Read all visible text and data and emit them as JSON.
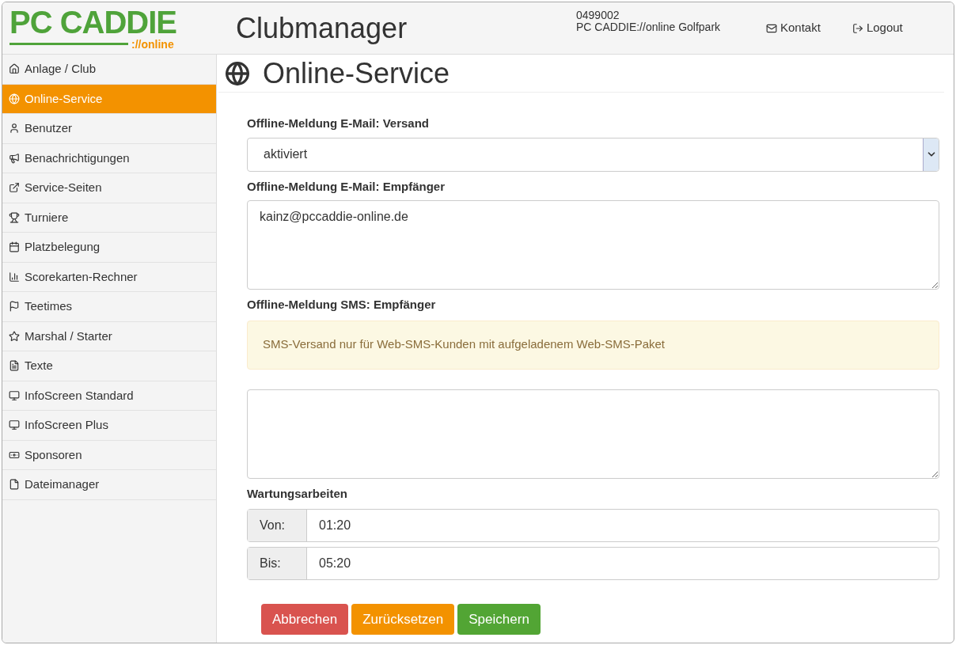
{
  "logo": {
    "main": "PC CADDIE",
    "sub": "://online"
  },
  "header": {
    "title": "Clubmanager",
    "club_id": "0499002",
    "club_name": "PC CADDIE://online Golfpark",
    "links": [
      "Kontakt",
      "Logout"
    ]
  },
  "sidebar": {
    "items": [
      {
        "label": "Anlage / Club",
        "selected": false
      },
      {
        "label": "Online-Service",
        "selected": true
      },
      {
        "label": "Benutzer",
        "selected": false
      },
      {
        "label": "Benachrichtigungen",
        "selected": false
      },
      {
        "label": "Service-Seiten",
        "selected": false
      },
      {
        "label": "Turniere",
        "selected": false
      },
      {
        "label": "Platzbelegung",
        "selected": false
      },
      {
        "label": "Scorekarten-Rechner",
        "selected": false
      },
      {
        "label": "Teetimes",
        "selected": false
      },
      {
        "label": "Marshal / Starter",
        "selected": false
      },
      {
        "label": "Texte",
        "selected": false
      },
      {
        "label": "InfoScreen Standard",
        "selected": false
      },
      {
        "label": "InfoScreen Plus",
        "selected": false
      },
      {
        "label": "Sponsoren",
        "selected": false
      },
      {
        "label": "Dateimanager",
        "selected": false
      }
    ]
  },
  "page": {
    "title": "Online-Service",
    "email_dispatch": {
      "label": "Offline-Meldung E-Mail: Versand",
      "value": "aktiviert"
    },
    "email_recipient": {
      "label": "Offline-Meldung E-Mail: Empfänger",
      "value": "kainz@pccaddie-online.de"
    },
    "sms_recipient": {
      "label": "Offline-Meldung SMS: Empfänger",
      "notice": "SMS-Versand nur für Web-SMS-Kunden mit aufgeladenem Web-SMS-Paket"
    },
    "maintenance": {
      "label": "Wartungsarbeiten",
      "rows": [
        {
          "label": "Von:",
          "value": "01:20"
        },
        {
          "label": "Bis:",
          "value": "05:20"
        }
      ]
    },
    "buttons": [
      {
        "label": "Abbrechen",
        "kind": "cancel"
      },
      {
        "label": "Zurücksetzen",
        "kind": "reset"
      },
      {
        "label": "Speichern",
        "kind": "save"
      }
    ]
  }
}
